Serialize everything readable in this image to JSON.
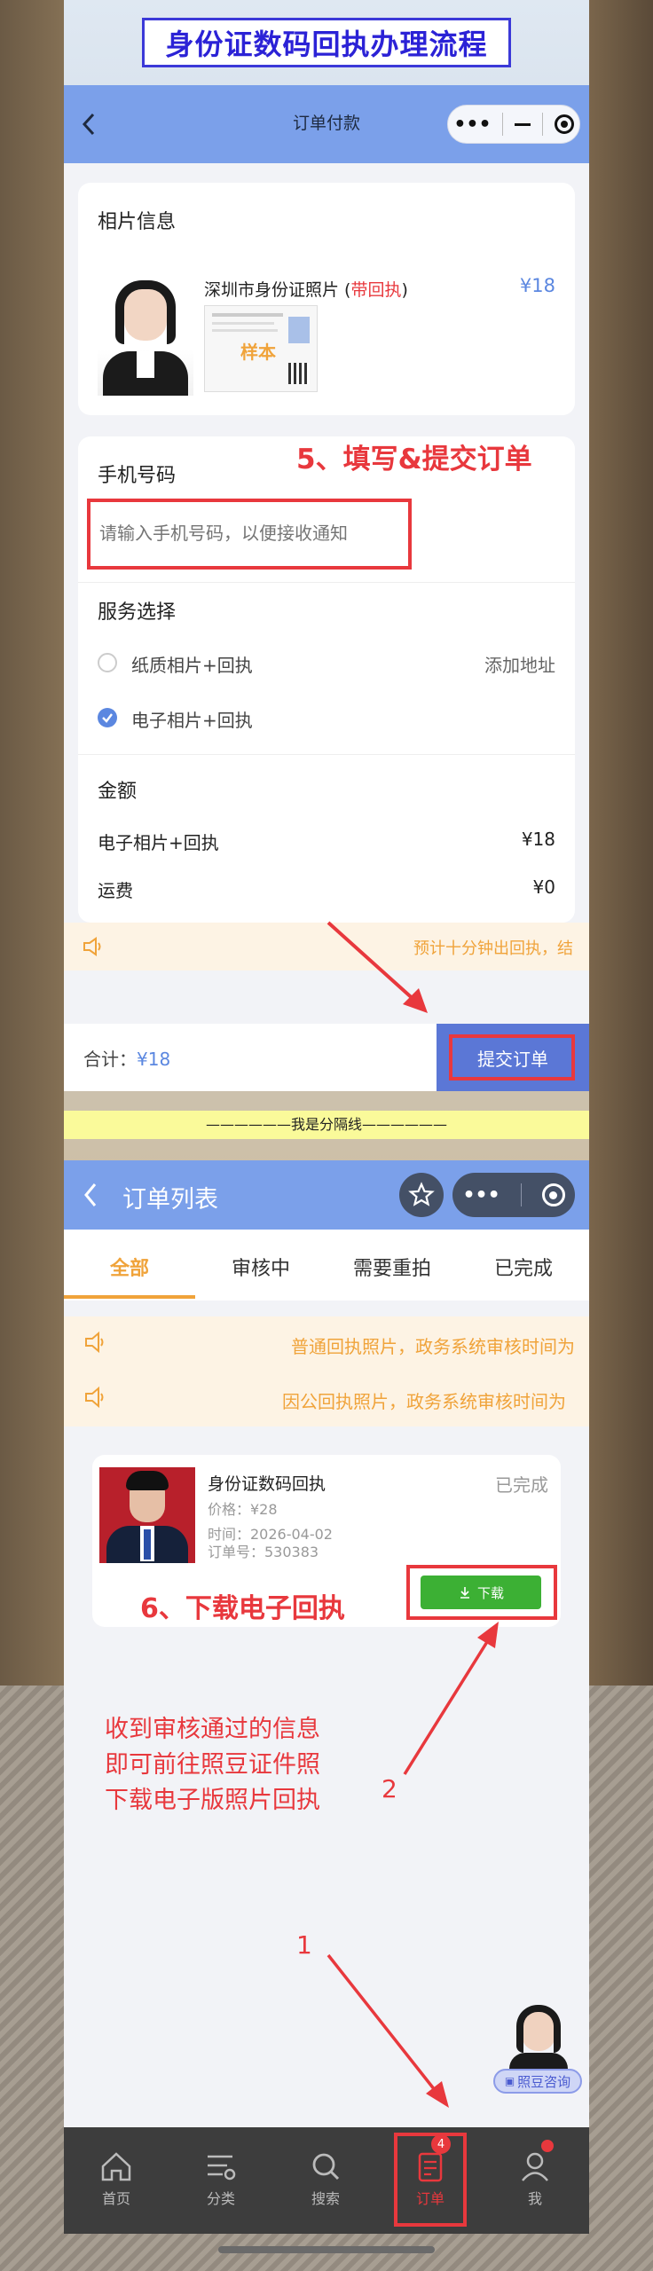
{
  "banner": {
    "title": "身份证数码回执办理流程"
  },
  "order_pay": {
    "nav_title": "订单付款",
    "photo_section": {
      "title": "相片信息",
      "product_name": "深圳市身份证照片",
      "paren_open": " (",
      "receipt_tag": "带回执",
      "paren_close": ")",
      "price": "¥18",
      "sample_label": "样本"
    },
    "phone_section": {
      "title": "手机号码",
      "placeholder": "请输入手机号码，以便接收通知"
    },
    "step5": "5、填写&提交订单",
    "service": {
      "title": "服务选择",
      "option1": "纸质相片+回执",
      "add_address": "添加地址",
      "option2": "电子相片+回执"
    },
    "amount": {
      "title": "金额",
      "item_label": "电子相片+回执",
      "item_price": "¥18",
      "freight_label": "运费",
      "freight_price": "¥0"
    },
    "notice": "预计十分钟出回执，结",
    "footer": {
      "total_label": "合计：",
      "total_value": "¥18",
      "submit": "提交订单"
    }
  },
  "divider": "——————我是分隔线——————",
  "order_list": {
    "nav_title": "订单列表",
    "tabs": [
      "全部",
      "审核中",
      "需要重拍",
      "已完成"
    ],
    "notices": [
      "普通回执照片，政务系统审核时间为",
      "因公回执照片，政务系统审核时间为"
    ],
    "order": {
      "name": "身份证数码回执",
      "status": "已完成",
      "price": "价格：¥28",
      "time": "时间：2026-04-02",
      "number": "订单号：530383",
      "download": "下载"
    },
    "step6": "6、下载电子回执",
    "annotation": [
      "收到审核通过的信息",
      "即可前往照豆证件照",
      "下载电子版照片回执"
    ],
    "marker1": "1",
    "marker2": "2",
    "consult": "照豆咨询",
    "tabbar": [
      {
        "label": "首页",
        "icon": "home-icon"
      },
      {
        "label": "分类",
        "icon": "category-icon"
      },
      {
        "label": "搜索",
        "icon": "search-icon"
      },
      {
        "label": "订单",
        "icon": "order-icon",
        "badge": "4"
      },
      {
        "label": "我",
        "icon": "user-icon"
      }
    ]
  },
  "colors": {
    "nav_blue": "#7ba0ea",
    "accent_red": "#e8383d",
    "orange": "#f0a33a",
    "green": "#3cb034"
  }
}
